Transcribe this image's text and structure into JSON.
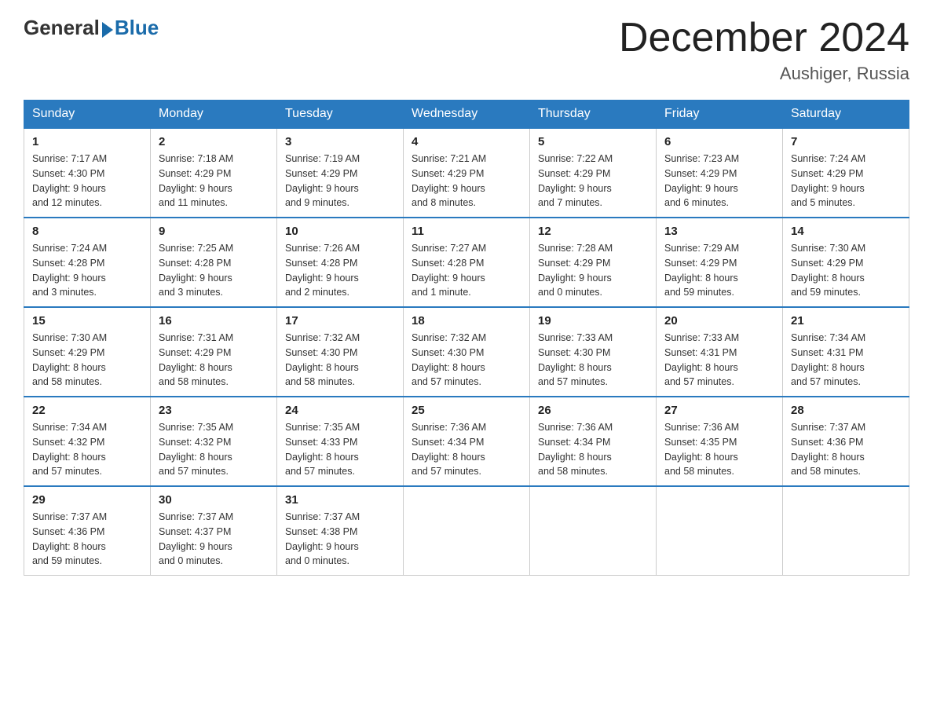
{
  "header": {
    "logo_general": "General",
    "logo_blue": "Blue",
    "month_title": "December 2024",
    "location": "Aushiger, Russia"
  },
  "weekdays": [
    "Sunday",
    "Monday",
    "Tuesday",
    "Wednesday",
    "Thursday",
    "Friday",
    "Saturday"
  ],
  "weeks": [
    [
      {
        "day": "1",
        "sunrise": "7:17 AM",
        "sunset": "4:30 PM",
        "daylight": "9 hours and 12 minutes."
      },
      {
        "day": "2",
        "sunrise": "7:18 AM",
        "sunset": "4:29 PM",
        "daylight": "9 hours and 11 minutes."
      },
      {
        "day": "3",
        "sunrise": "7:19 AM",
        "sunset": "4:29 PM",
        "daylight": "9 hours and 9 minutes."
      },
      {
        "day": "4",
        "sunrise": "7:21 AM",
        "sunset": "4:29 PM",
        "daylight": "9 hours and 8 minutes."
      },
      {
        "day": "5",
        "sunrise": "7:22 AM",
        "sunset": "4:29 PM",
        "daylight": "9 hours and 7 minutes."
      },
      {
        "day": "6",
        "sunrise": "7:23 AM",
        "sunset": "4:29 PM",
        "daylight": "9 hours and 6 minutes."
      },
      {
        "day": "7",
        "sunrise": "7:24 AM",
        "sunset": "4:29 PM",
        "daylight": "9 hours and 5 minutes."
      }
    ],
    [
      {
        "day": "8",
        "sunrise": "7:24 AM",
        "sunset": "4:28 PM",
        "daylight": "9 hours and 3 minutes."
      },
      {
        "day": "9",
        "sunrise": "7:25 AM",
        "sunset": "4:28 PM",
        "daylight": "9 hours and 3 minutes."
      },
      {
        "day": "10",
        "sunrise": "7:26 AM",
        "sunset": "4:28 PM",
        "daylight": "9 hours and 2 minutes."
      },
      {
        "day": "11",
        "sunrise": "7:27 AM",
        "sunset": "4:28 PM",
        "daylight": "9 hours and 1 minute."
      },
      {
        "day": "12",
        "sunrise": "7:28 AM",
        "sunset": "4:29 PM",
        "daylight": "9 hours and 0 minutes."
      },
      {
        "day": "13",
        "sunrise": "7:29 AM",
        "sunset": "4:29 PM",
        "daylight": "8 hours and 59 minutes."
      },
      {
        "day": "14",
        "sunrise": "7:30 AM",
        "sunset": "4:29 PM",
        "daylight": "8 hours and 59 minutes."
      }
    ],
    [
      {
        "day": "15",
        "sunrise": "7:30 AM",
        "sunset": "4:29 PM",
        "daylight": "8 hours and 58 minutes."
      },
      {
        "day": "16",
        "sunrise": "7:31 AM",
        "sunset": "4:29 PM",
        "daylight": "8 hours and 58 minutes."
      },
      {
        "day": "17",
        "sunrise": "7:32 AM",
        "sunset": "4:30 PM",
        "daylight": "8 hours and 58 minutes."
      },
      {
        "day": "18",
        "sunrise": "7:32 AM",
        "sunset": "4:30 PM",
        "daylight": "8 hours and 57 minutes."
      },
      {
        "day": "19",
        "sunrise": "7:33 AM",
        "sunset": "4:30 PM",
        "daylight": "8 hours and 57 minutes."
      },
      {
        "day": "20",
        "sunrise": "7:33 AM",
        "sunset": "4:31 PM",
        "daylight": "8 hours and 57 minutes."
      },
      {
        "day": "21",
        "sunrise": "7:34 AM",
        "sunset": "4:31 PM",
        "daylight": "8 hours and 57 minutes."
      }
    ],
    [
      {
        "day": "22",
        "sunrise": "7:34 AM",
        "sunset": "4:32 PM",
        "daylight": "8 hours and 57 minutes."
      },
      {
        "day": "23",
        "sunrise": "7:35 AM",
        "sunset": "4:32 PM",
        "daylight": "8 hours and 57 minutes."
      },
      {
        "day": "24",
        "sunrise": "7:35 AM",
        "sunset": "4:33 PM",
        "daylight": "8 hours and 57 minutes."
      },
      {
        "day": "25",
        "sunrise": "7:36 AM",
        "sunset": "4:34 PM",
        "daylight": "8 hours and 57 minutes."
      },
      {
        "day": "26",
        "sunrise": "7:36 AM",
        "sunset": "4:34 PM",
        "daylight": "8 hours and 58 minutes."
      },
      {
        "day": "27",
        "sunrise": "7:36 AM",
        "sunset": "4:35 PM",
        "daylight": "8 hours and 58 minutes."
      },
      {
        "day": "28",
        "sunrise": "7:37 AM",
        "sunset": "4:36 PM",
        "daylight": "8 hours and 58 minutes."
      }
    ],
    [
      {
        "day": "29",
        "sunrise": "7:37 AM",
        "sunset": "4:36 PM",
        "daylight": "8 hours and 59 minutes."
      },
      {
        "day": "30",
        "sunrise": "7:37 AM",
        "sunset": "4:37 PM",
        "daylight": "9 hours and 0 minutes."
      },
      {
        "day": "31",
        "sunrise": "7:37 AM",
        "sunset": "4:38 PM",
        "daylight": "9 hours and 0 minutes."
      },
      null,
      null,
      null,
      null
    ]
  ],
  "labels": {
    "sunrise": "Sunrise:",
    "sunset": "Sunset:",
    "daylight": "Daylight:"
  }
}
